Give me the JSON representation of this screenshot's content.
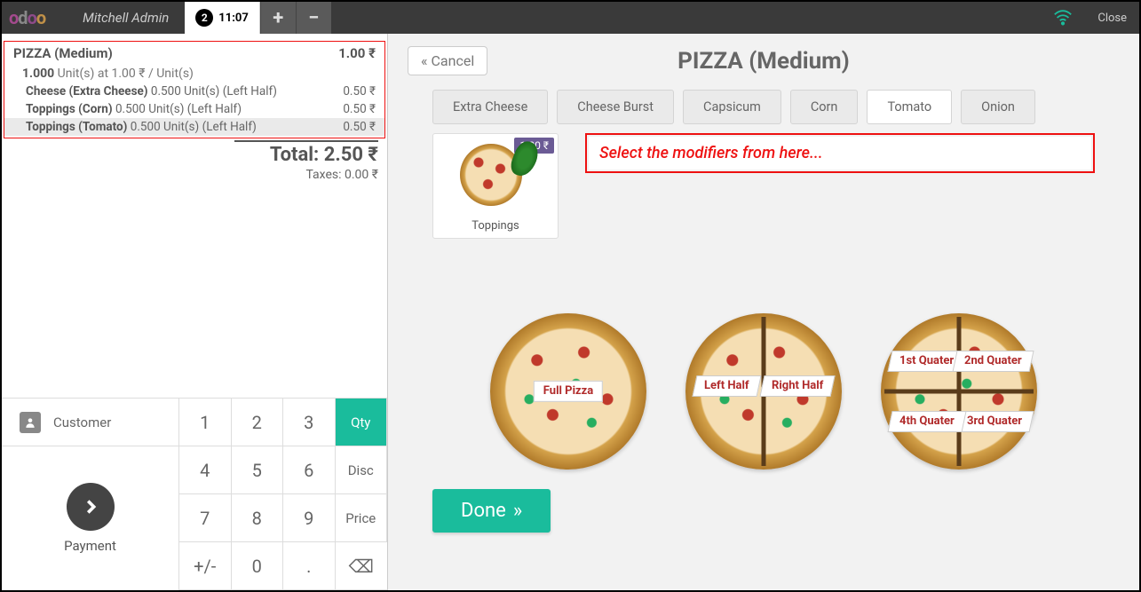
{
  "topbar": {
    "logo_text": "odoo",
    "admin_name": "Mitchell Admin",
    "session_number": "2",
    "session_time": "11:07",
    "close_label": "Close"
  },
  "order": {
    "product_name": "PIZZA (Medium)",
    "product_price": "1.00 ₹",
    "qty_line_qty": "1.000",
    "qty_line_rest": " Unit(s) at 1.00 ₹ / Unit(s)",
    "mods": [
      {
        "name": "Cheese (Extra Cheese)",
        "detail": " 0.500 Unit(s) (Left Half)",
        "price": "0.50 ₹",
        "selected": false
      },
      {
        "name": "Toppings (Corn)",
        "detail": " 0.500 Unit(s) (Left Half)",
        "price": "0.50 ₹",
        "selected": false
      },
      {
        "name": "Toppings (Tomato)",
        "detail": " 0.500 Unit(s) (Left Half)",
        "price": "0.50 ₹",
        "selected": true
      }
    ],
    "total_label": "Total: 2.50 ₹",
    "taxes_label": "Taxes: 0.00 ₹"
  },
  "keypad": {
    "customer_label": "Customer",
    "payment_label": "Payment",
    "keys": [
      "1",
      "2",
      "3",
      "4",
      "5",
      "6",
      "7",
      "8",
      "9",
      "+/-",
      "0",
      "."
    ],
    "qty_label": "Qty",
    "disc_label": "Disc",
    "price_label": "Price",
    "backspace_glyph": "⌫"
  },
  "right": {
    "cancel_label": "Cancel",
    "title": "PIZZA (Medium)",
    "tabs": [
      {
        "label": "Extra Cheese",
        "active": false
      },
      {
        "label": "Cheese Burst",
        "active": false
      },
      {
        "label": "Capsicum",
        "active": false
      },
      {
        "label": "Corn",
        "active": false
      },
      {
        "label": "Tomato",
        "active": true
      },
      {
        "label": "Onion",
        "active": false
      }
    ],
    "product_badge": "1.00 ₹",
    "product_label": "Toppings",
    "callout_text": "Select the modifiers from here...",
    "portions": {
      "full": "Full Pizza",
      "left": "Left Half",
      "right": "Right Half",
      "q1": "1st Quater",
      "q2": "2nd Quater",
      "q3": "3rd Quater",
      "q4": "4th Quater"
    },
    "done_label": "Done"
  }
}
